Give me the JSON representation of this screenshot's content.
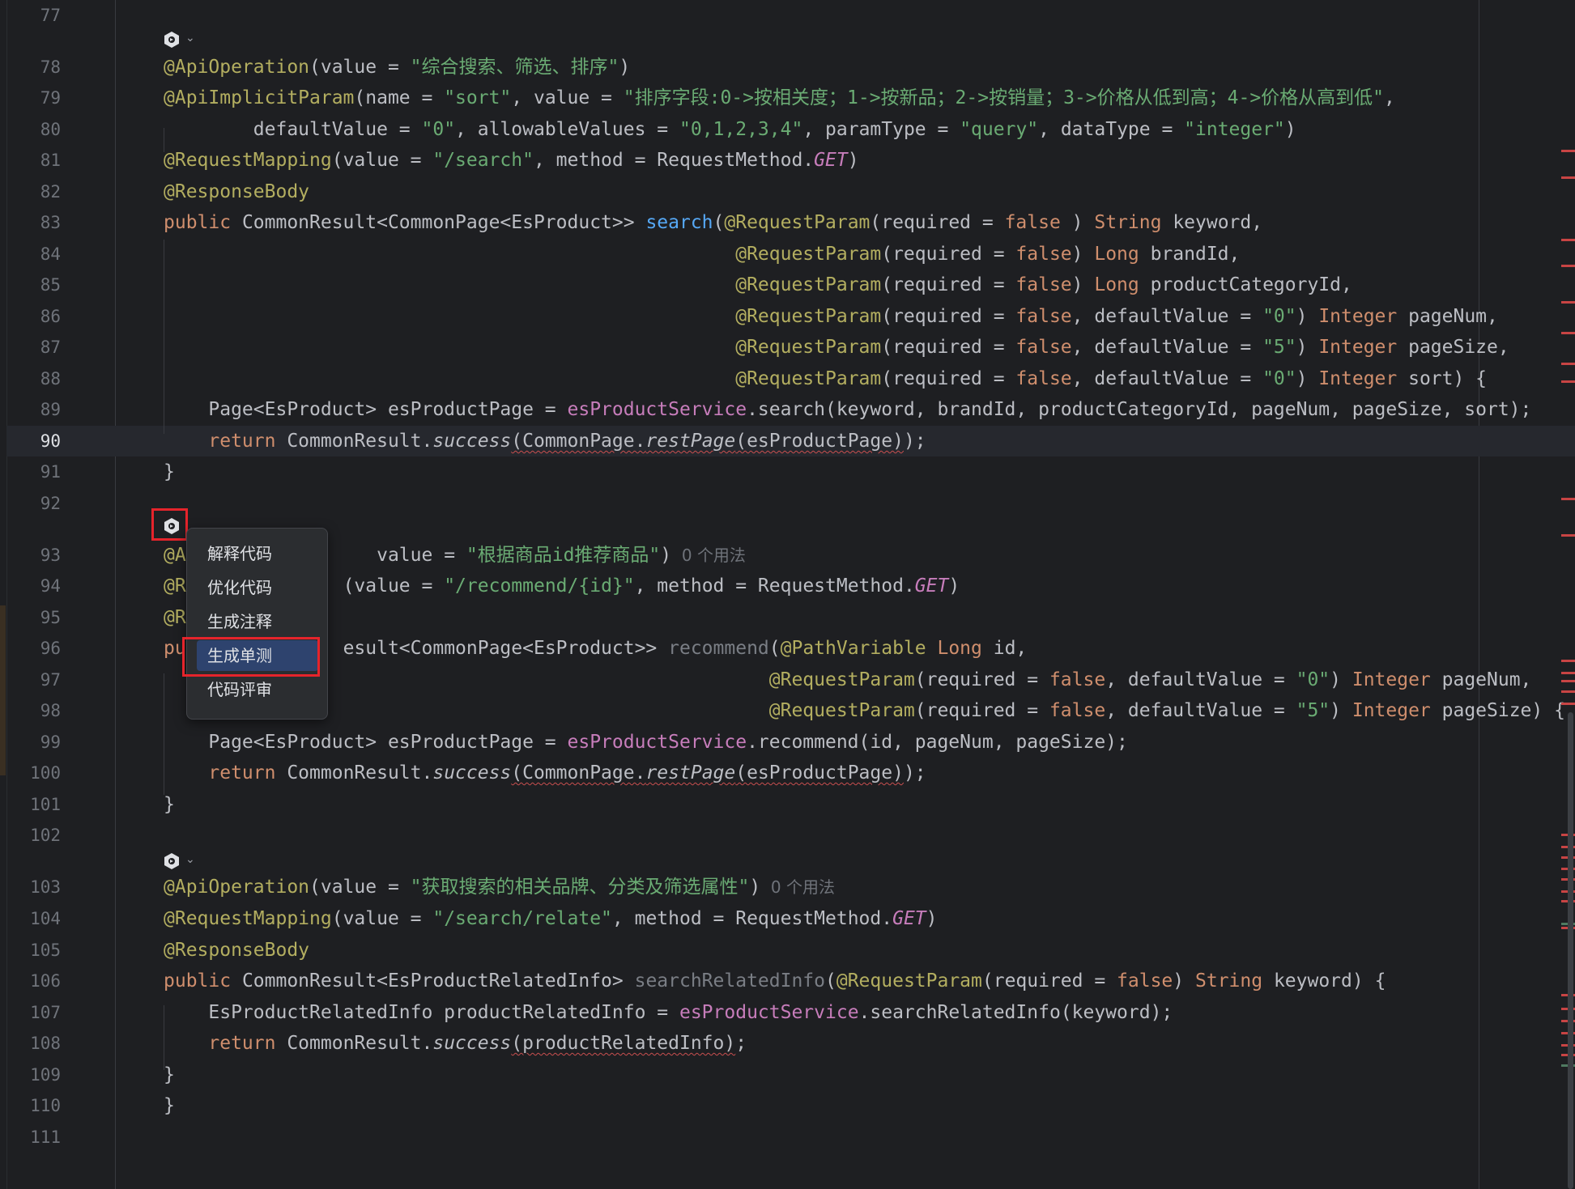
{
  "editor": {
    "lines": [
      {
        "n": "77",
        "segs": []
      },
      {
        "n": "78",
        "segs": [
          [
            "ann",
            "@ApiOperation"
          ],
          [
            "",
            "(value = "
          ],
          [
            "str",
            "\"综合搜索、筛选、排序\""
          ],
          [
            "",
            ")"
          ]
        ]
      },
      {
        "n": "79",
        "segs": [
          [
            "ann",
            "@ApiImplicitParam"
          ],
          [
            "",
            "(name = "
          ],
          [
            "str",
            "\"sort\""
          ],
          [
            "",
            ", value = "
          ],
          [
            "str",
            "\"排序字段:0->按相关度；1->按新品；2->按销量；3->价格从低到高；4->价格从高到低\""
          ],
          [
            "",
            ","
          ]
        ]
      },
      {
        "n": "80",
        "segs": [
          [
            "",
            "        defaultValue = "
          ],
          [
            "str",
            "\"0\""
          ],
          [
            "",
            ", allowableValues = "
          ],
          [
            "str",
            "\"0,1,2,3,4\""
          ],
          [
            "",
            ", paramType = "
          ],
          [
            "str",
            "\"query\""
          ],
          [
            "",
            ", dataType = "
          ],
          [
            "str",
            "\"integer\""
          ],
          [
            "",
            ")"
          ]
        ]
      },
      {
        "n": "81",
        "segs": [
          [
            "ann",
            "@RequestMapping"
          ],
          [
            "",
            "(value = "
          ],
          [
            "str",
            "\"/search\""
          ],
          [
            "",
            ", method = RequestMethod."
          ],
          [
            "cst",
            "GET"
          ],
          [
            "",
            ")"
          ]
        ]
      },
      {
        "n": "82",
        "segs": [
          [
            "ann",
            "@ResponseBody"
          ]
        ]
      },
      {
        "n": "83",
        "segs": [
          [
            "kw",
            "public "
          ],
          [
            "",
            "CommonResult<CommonPage<EsProduct>> "
          ],
          [
            "fn",
            "search"
          ],
          [
            "",
            "("
          ],
          [
            "ann",
            "@RequestParam"
          ],
          [
            "",
            "(required = "
          ],
          [
            "kw",
            "false"
          ],
          [
            "",
            " ) "
          ],
          [
            "kw",
            "String"
          ],
          [
            "",
            " keyword,"
          ]
        ]
      },
      {
        "n": "84",
        "segs": [
          [
            "",
            "                                                   "
          ],
          [
            "ann",
            "@RequestParam"
          ],
          [
            "",
            "(required = "
          ],
          [
            "kw",
            "false"
          ],
          [
            "",
            ") "
          ],
          [
            "kw",
            "Long"
          ],
          [
            "",
            " brandId,"
          ]
        ]
      },
      {
        "n": "85",
        "segs": [
          [
            "",
            "                                                   "
          ],
          [
            "ann",
            "@RequestParam"
          ],
          [
            "",
            "(required = "
          ],
          [
            "kw",
            "false"
          ],
          [
            "",
            ") "
          ],
          [
            "kw",
            "Long"
          ],
          [
            "",
            " productCategoryId,"
          ]
        ]
      },
      {
        "n": "86",
        "segs": [
          [
            "",
            "                                                   "
          ],
          [
            "ann",
            "@RequestParam"
          ],
          [
            "",
            "(required = "
          ],
          [
            "kw",
            "false"
          ],
          [
            "",
            ", defaultValue = "
          ],
          [
            "str",
            "\"0\""
          ],
          [
            "",
            ") "
          ],
          [
            "kw",
            "Integer"
          ],
          [
            "",
            " pageNum,"
          ]
        ]
      },
      {
        "n": "87",
        "segs": [
          [
            "",
            "                                                   "
          ],
          [
            "ann",
            "@RequestParam"
          ],
          [
            "",
            "(required = "
          ],
          [
            "kw",
            "false"
          ],
          [
            "",
            ", defaultValue = "
          ],
          [
            "str",
            "\"5\""
          ],
          [
            "",
            ") "
          ],
          [
            "kw",
            "Integer"
          ],
          [
            "",
            " pageSize,"
          ]
        ]
      },
      {
        "n": "88",
        "segs": [
          [
            "",
            "                                                   "
          ],
          [
            "ann",
            "@RequestParam"
          ],
          [
            "",
            "(required = "
          ],
          [
            "kw",
            "false"
          ],
          [
            "",
            ", defaultValue = "
          ],
          [
            "str",
            "\"0\""
          ],
          [
            "",
            ") "
          ],
          [
            "kw",
            "Integer"
          ],
          [
            "",
            " sort) {"
          ]
        ]
      },
      {
        "n": "89",
        "segs": [
          [
            "",
            "    Page<EsProduct> esProductPage = "
          ],
          [
            "fld",
            "esProductService"
          ],
          [
            "",
            ".search(keyword, brandId, productCategoryId, pageNum, pageSize, sort);"
          ]
        ]
      },
      {
        "n": "90",
        "current": true,
        "segs": [
          [
            "kw",
            "    return "
          ],
          [
            "",
            "CommonResult."
          ],
          [
            "it",
            "success"
          ],
          [
            "sq",
            "(CommonPage."
          ],
          [
            "sqit",
            "restPage"
          ],
          [
            "sq",
            "(esProductPage)"
          ],
          [
            "",
            ");"
          ]
        ]
      },
      {
        "n": "91",
        "segs": [
          [
            "",
            "}"
          ]
        ]
      },
      {
        "n": "92",
        "segs": []
      },
      {
        "n": "93",
        "segs": [
          [
            "ann",
            "@A"
          ],
          [
            "",
            "                 "
          ],
          [
            "",
            "value = "
          ],
          [
            "str",
            "\"根据商品id推荐商品\""
          ],
          [
            "",
            ")"
          ],
          [
            "hint",
            "  0 个用法"
          ]
        ]
      },
      {
        "n": "94",
        "segs": [
          [
            "ann",
            "@R"
          ],
          [
            "",
            "              (value = "
          ],
          [
            "str",
            "\"/recommend/{id}\""
          ],
          [
            "",
            ", method = RequestMethod."
          ],
          [
            "cst",
            "GET"
          ],
          [
            "",
            ")"
          ]
        ]
      },
      {
        "n": "95",
        "segs": [
          [
            "ann",
            "@R"
          ]
        ]
      },
      {
        "n": "96",
        "segs": [
          [
            "kw",
            "pu"
          ],
          [
            "",
            "              esult<CommonPage<EsProduct>> "
          ],
          [
            "dim",
            "recommend"
          ],
          [
            "",
            "("
          ],
          [
            "ann",
            "@PathVariable"
          ],
          [
            "kw",
            " Long"
          ],
          [
            "",
            " id,"
          ]
        ]
      },
      {
        "n": "97",
        "segs": [
          [
            "",
            "                                                      "
          ],
          [
            "ann",
            "@RequestParam"
          ],
          [
            "",
            "(required = "
          ],
          [
            "kw",
            "false"
          ],
          [
            "",
            ", defaultValue = "
          ],
          [
            "str",
            "\"0\""
          ],
          [
            "",
            ") "
          ],
          [
            "kw",
            "Integer"
          ],
          [
            "",
            " pageNum,"
          ]
        ]
      },
      {
        "n": "98",
        "segs": [
          [
            "",
            "                                                      "
          ],
          [
            "ann",
            "@RequestParam"
          ],
          [
            "",
            "(required = "
          ],
          [
            "kw",
            "false"
          ],
          [
            "",
            ", defaultValue = "
          ],
          [
            "str",
            "\"5\""
          ],
          [
            "",
            ") "
          ],
          [
            "kw",
            "Integer"
          ],
          [
            "",
            " pageSize) {"
          ]
        ]
      },
      {
        "n": "99",
        "segs": [
          [
            "",
            "    Page<EsProduct> esProductPage = "
          ],
          [
            "fld",
            "esProductService"
          ],
          [
            "",
            ".recommend(id, pageNum, pageSize);"
          ]
        ]
      },
      {
        "n": "100",
        "segs": [
          [
            "kw",
            "    return "
          ],
          [
            "",
            "CommonResult."
          ],
          [
            "it",
            "success"
          ],
          [
            "sq",
            "(CommonPage."
          ],
          [
            "sqit",
            "restPage"
          ],
          [
            "sq",
            "(esProductPage)"
          ],
          [
            "",
            ");"
          ]
        ]
      },
      {
        "n": "101",
        "segs": [
          [
            "",
            "}"
          ]
        ]
      },
      {
        "n": "102",
        "segs": []
      },
      {
        "n": "103",
        "segs": [
          [
            "ann",
            "@ApiOperation"
          ],
          [
            "",
            "(value = "
          ],
          [
            "str",
            "\"获取搜索的相关品牌、分类及筛选属性\""
          ],
          [
            "",
            ")"
          ],
          [
            "hint",
            "  0 个用法"
          ]
        ]
      },
      {
        "n": "104",
        "segs": [
          [
            "ann",
            "@RequestMapping"
          ],
          [
            "",
            "(value = "
          ],
          [
            "str",
            "\"/search/relate\""
          ],
          [
            "",
            ", method = RequestMethod."
          ],
          [
            "cst",
            "GET"
          ],
          [
            "",
            ")"
          ]
        ]
      },
      {
        "n": "105",
        "segs": [
          [
            "ann",
            "@ResponseBody"
          ]
        ]
      },
      {
        "n": "106",
        "segs": [
          [
            "kw",
            "public "
          ],
          [
            "",
            "CommonResult<EsProductRelatedInfo> "
          ],
          [
            "dim",
            "searchRelatedInfo"
          ],
          [
            "",
            "("
          ],
          [
            "ann",
            "@RequestParam"
          ],
          [
            "",
            "(required = "
          ],
          [
            "kw",
            "false"
          ],
          [
            "",
            ") "
          ],
          [
            "kw",
            "String"
          ],
          [
            "",
            " keyword) {"
          ]
        ]
      },
      {
        "n": "107",
        "segs": [
          [
            "",
            "    EsProductRelatedInfo productRelatedInfo = "
          ],
          [
            "fld",
            "esProductService"
          ],
          [
            "",
            ".searchRelatedInfo(keyword);"
          ]
        ]
      },
      {
        "n": "108",
        "segs": [
          [
            "kw",
            "    return "
          ],
          [
            "",
            "CommonResult."
          ],
          [
            "it",
            "success"
          ],
          [
            "sq",
            "(productRelatedInfo)"
          ],
          [
            "",
            ";"
          ]
        ]
      },
      {
        "n": "109",
        "segs": [
          [
            "",
            "}"
          ]
        ]
      },
      {
        "n": "110",
        "segs": [
          [
            "",
            "}"
          ]
        ]
      },
      {
        "n": "111",
        "segs": []
      }
    ]
  },
  "context_menu": {
    "items": [
      {
        "label": "解释代码",
        "selected": false
      },
      {
        "label": "优化代码",
        "selected": false
      },
      {
        "label": "生成注释",
        "selected": false
      },
      {
        "label": "生成单测",
        "selected": true
      },
      {
        "label": "代码评审",
        "selected": false
      }
    ]
  },
  "icons": {
    "plugin_icon": "ai-assistant-icon",
    "chevron": "chevron-down-icon"
  },
  "colors": {
    "highlight_border": "#e5242b",
    "menu_selected": "#2e436e"
  }
}
